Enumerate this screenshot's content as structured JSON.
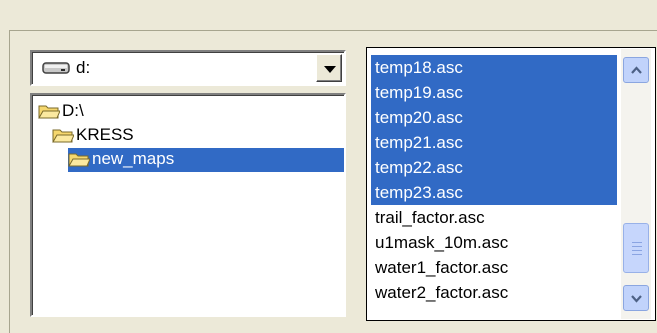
{
  "drive_selector": {
    "value": "d:",
    "icon": "drive-icon"
  },
  "folder_tree": {
    "items": [
      {
        "label": "D:\\",
        "icon": "open-folder-icon",
        "selected": false
      },
      {
        "label": "KRESS",
        "icon": "open-folder-icon",
        "selected": false
      },
      {
        "label": "new_maps",
        "icon": "open-folder-icon",
        "selected": true
      }
    ]
  },
  "file_list": {
    "items": [
      {
        "label": "temp18.asc",
        "selected": true
      },
      {
        "label": "temp19.asc",
        "selected": true
      },
      {
        "label": "temp20.asc",
        "selected": true
      },
      {
        "label": "temp21.asc",
        "selected": true
      },
      {
        "label": "temp22.asc",
        "selected": true
      },
      {
        "label": "temp23.asc",
        "selected": true
      },
      {
        "label": "trail_factor.asc",
        "selected": false
      },
      {
        "label": "u1mask_10m.asc",
        "selected": false
      },
      {
        "label": "water1_factor.asc",
        "selected": false
      },
      {
        "label": "water2_factor.asc",
        "selected": false
      }
    ]
  },
  "colors": {
    "selection": "#316ac5",
    "dialog_background": "#ece9d8"
  }
}
